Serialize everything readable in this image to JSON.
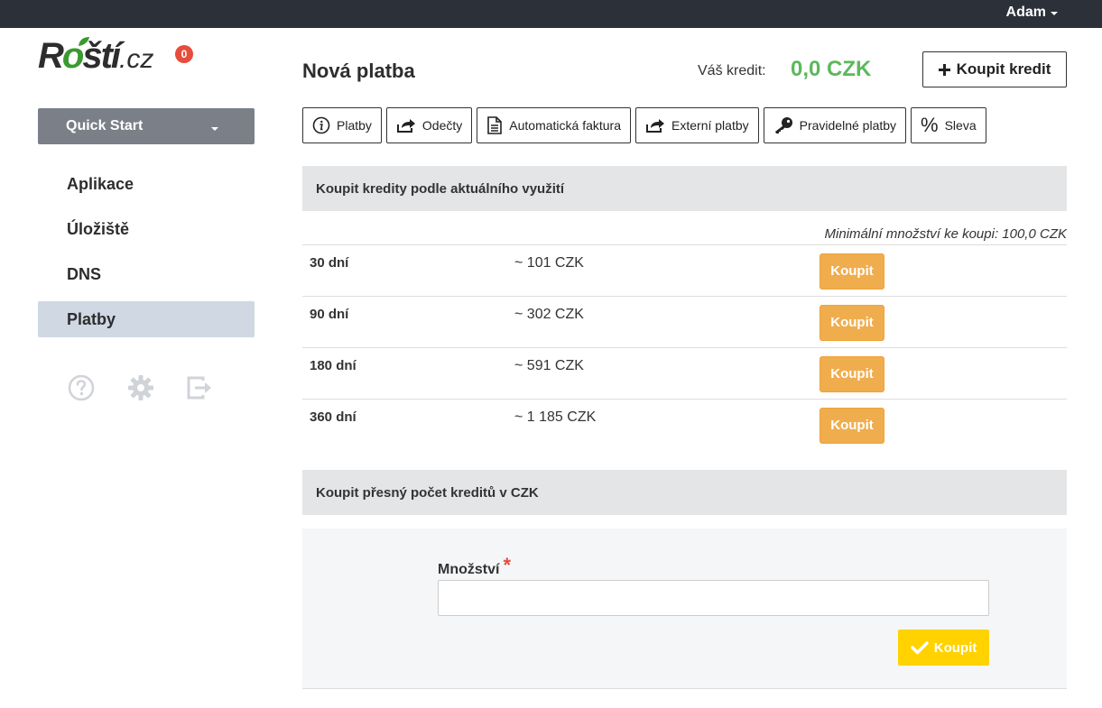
{
  "topbar": {
    "user_name": "Adam"
  },
  "logo": {
    "brand_main": "R",
    "brand_o": "o",
    "brand_rest": "ští",
    "brand_tld": ".cz",
    "notification_count": "0"
  },
  "sidebar": {
    "quick_start": "Quick Start",
    "items": [
      {
        "label": "Aplikace",
        "active": false
      },
      {
        "label": "Úložiště",
        "active": false
      },
      {
        "label": "DNS",
        "active": false
      },
      {
        "label": "Platby",
        "active": true
      }
    ],
    "footer_icons": [
      "help-icon",
      "gear-icon",
      "logout-icon"
    ]
  },
  "header": {
    "title": "Nová platba",
    "credit_label": "Váš kredit:",
    "credit_value": "0,0 CZK",
    "buy_credit_label": "Koupit kredit"
  },
  "tabs": [
    {
      "label": "Platby",
      "icon": "info-icon"
    },
    {
      "label": "Odečty",
      "icon": "share-icon"
    },
    {
      "label": "Automatická faktura",
      "icon": "document-icon"
    },
    {
      "label": "Externí platby",
      "icon": "share-icon"
    },
    {
      "label": "Pravidelné platby",
      "icon": "key-icon"
    },
    {
      "label": "Sleva",
      "icon": "percent-icon"
    }
  ],
  "usage_section": {
    "heading": "Koupit kredity podle aktuálního využití",
    "min_note": "Minimální množství ke koupi: 100,0 CZK",
    "rows": [
      {
        "days": "30 dní",
        "price": "~ 101 CZK",
        "button": "Koupit"
      },
      {
        "days": "90 dní",
        "price": "~ 302 CZK",
        "button": "Koupit"
      },
      {
        "days": "180 dní",
        "price": "~ 591 CZK",
        "button": "Koupit"
      },
      {
        "days": "360 dní",
        "price": "~ 1 185 CZK",
        "button": "Koupit"
      }
    ]
  },
  "exact_section": {
    "heading": "Koupit přesný počet kreditů v CZK",
    "field_label": "Množství",
    "required_mark": "*",
    "field_value": "",
    "submit_label": "Koupit"
  },
  "colors": {
    "topbar": "#2b3039",
    "credit_green": "#5cb85c",
    "buy_orange": "#f0ad4e",
    "submit_yellow": "#ffd200",
    "active_item": "#cfd8e3",
    "badge_red": "#e74c3c"
  }
}
